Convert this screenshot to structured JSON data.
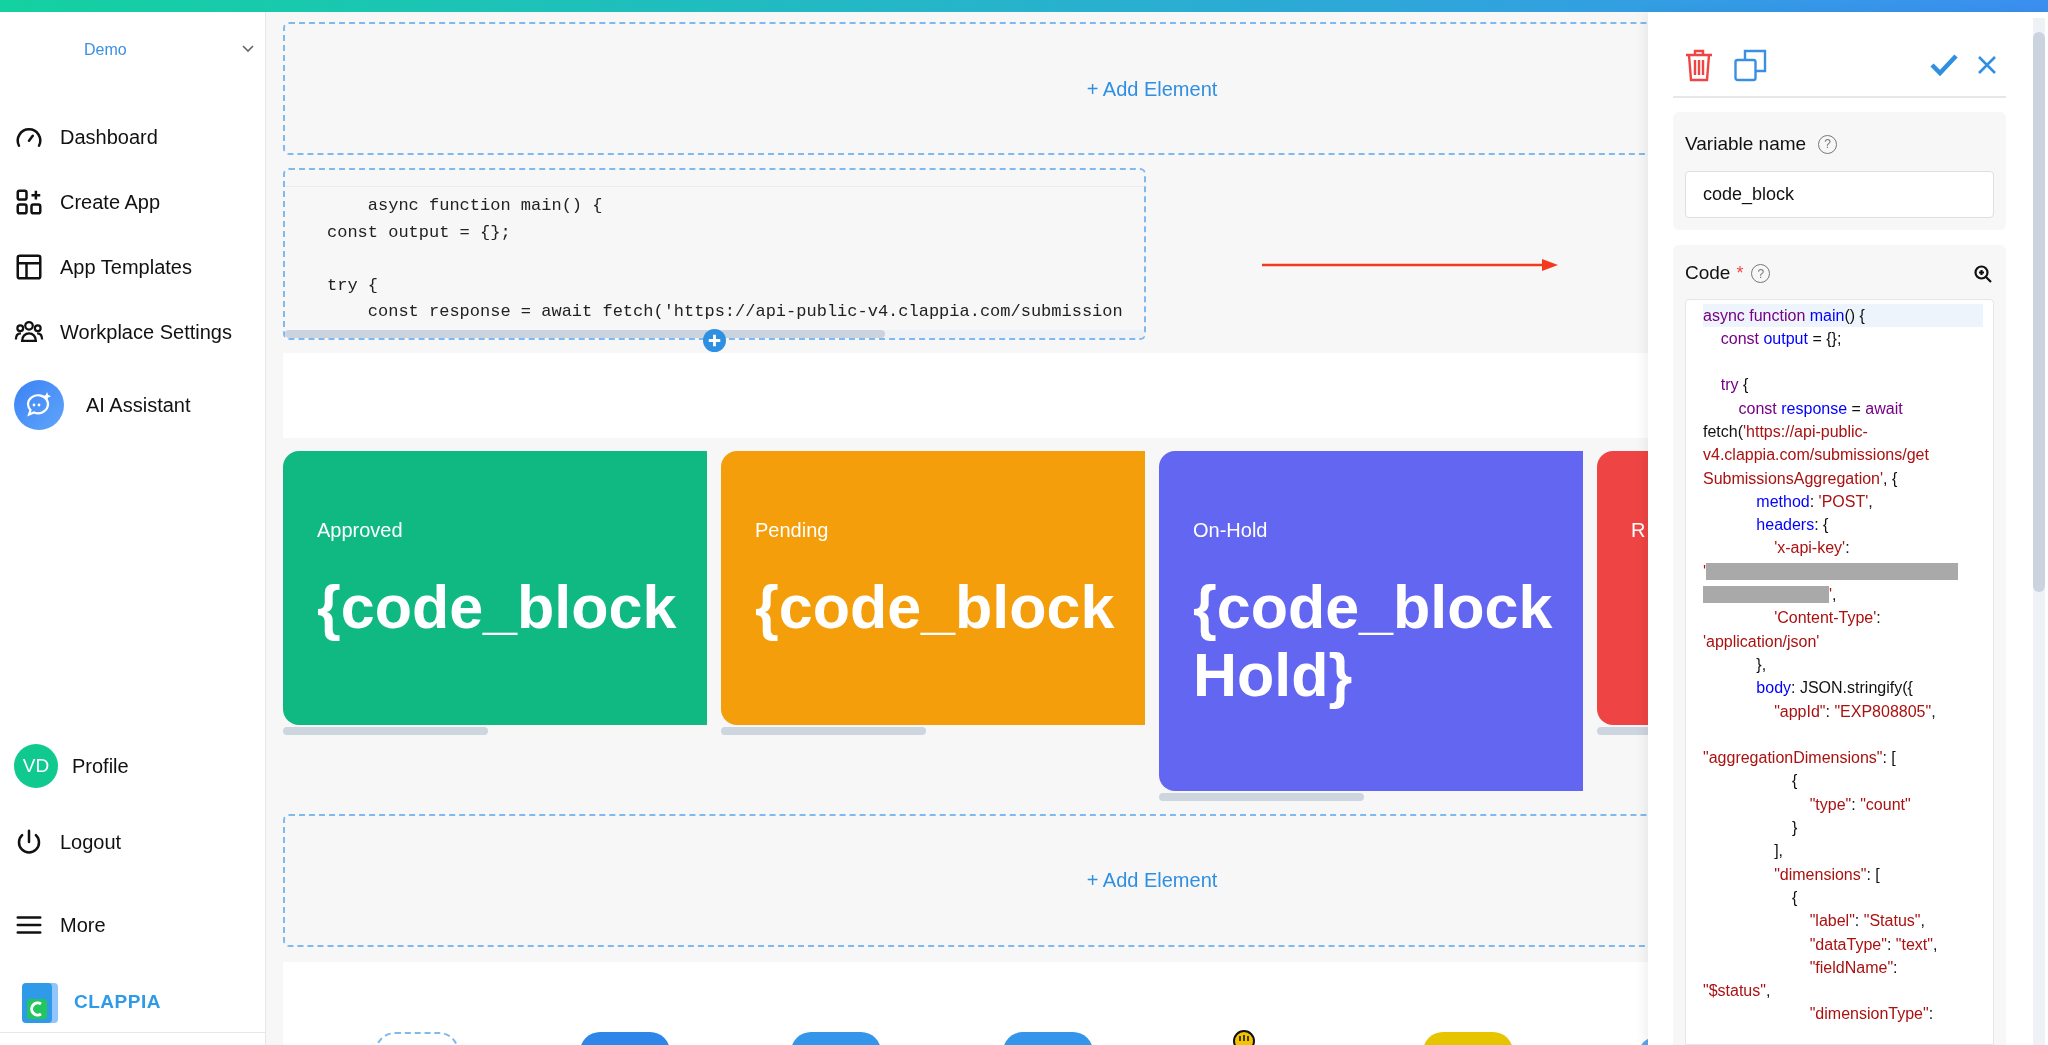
{
  "sidebar": {
    "workspace": "Demo",
    "items": [
      {
        "label": "Dashboard",
        "kind": "gauge"
      },
      {
        "label": "Create App",
        "kind": "grid-plus"
      },
      {
        "label": "App Templates",
        "kind": "layout"
      },
      {
        "label": "Workplace Settings",
        "kind": "users"
      },
      {
        "label": "AI Assistant",
        "kind": "ai"
      }
    ],
    "bottom_items": [
      {
        "label": "Profile",
        "kind": "avatar",
        "initials": "VD"
      },
      {
        "label": "Logout",
        "kind": "power"
      },
      {
        "label": "More",
        "kind": "menu"
      }
    ],
    "brand": "CLAPPIA"
  },
  "canvas": {
    "add_element_top": "+ Add Element",
    "code_preview": [
      [
        "    async function main() {",
        "const output = {};"
      ],
      [
        "try {",
        "    const response = await fetch('https://api-public-v4.clappia.com/submission"
      ]
    ],
    "cards": [
      {
        "label": "Approved",
        "value": "{code_block",
        "color": "#10b981"
      },
      {
        "label": "Pending",
        "value": "{code_block",
        "color": "#f59e0b"
      },
      {
        "label": "On-Hold",
        "value": "{code_block Hold}",
        "color": "#6366f1"
      },
      {
        "label": "R",
        "color": "#ef4444"
      }
    ],
    "add_element_bottom": "+ Add Element"
  },
  "panel": {
    "help_mark": "?",
    "variable_label": "Variable name",
    "variable_value": "code_block",
    "code_label": "Code",
    "required_mark": "*",
    "code_lines": [
      {
        "highlighted": true,
        "tokens": [
          {
            "kind": "keyword",
            "text": "async function "
          },
          {
            "kind": "name",
            "text": "main"
          },
          {
            "kind": "plain",
            "text": "() {"
          }
        ]
      },
      {
        "highlighted": false,
        "tokens": [
          {
            "kind": "keyword",
            "text": "    const "
          },
          {
            "kind": "name",
            "text": "output"
          },
          {
            "kind": "plain",
            "text": " = {};"
          }
        ]
      },
      {
        "highlighted": false,
        "gap_before": true,
        "tokens": [
          {
            "kind": "keyword",
            "text": "    try"
          },
          {
            "kind": "plain",
            "text": " {"
          }
        ]
      },
      {
        "highlighted": false,
        "tokens": [
          {
            "kind": "keyword",
            "text": "        const "
          },
          {
            "kind": "name",
            "text": "response"
          },
          {
            "kind": "plain",
            "text": " = "
          },
          {
            "kind": "keyword",
            "text": "await"
          }
        ]
      },
      {
        "highlighted": false,
        "tokens": [
          {
            "kind": "plain",
            "text": "fetch("
          },
          {
            "kind": "string",
            "text": "'https://api-public-"
          }
        ]
      },
      {
        "highlighted": false,
        "tokens": [
          {
            "kind": "string",
            "text": "v4.clappia.com/submissions/get"
          }
        ]
      },
      {
        "highlighted": false,
        "tokens": [
          {
            "kind": "string",
            "text": "SubmissionsAggregation'"
          },
          {
            "kind": "plain",
            "text": ", {"
          }
        ]
      },
      {
        "highlighted": false,
        "tokens": [
          {
            "kind": "name",
            "text": "            method"
          },
          {
            "kind": "plain",
            "text": ": "
          },
          {
            "kind": "string",
            "text": "'POST'"
          },
          {
            "kind": "plain",
            "text": ","
          }
        ]
      },
      {
        "highlighted": false,
        "tokens": [
          {
            "kind": "name",
            "text": "            headers"
          },
          {
            "kind": "plain",
            "text": ": {"
          }
        ]
      },
      {
        "highlighted": false,
        "tokens": [
          {
            "kind": "string",
            "text": "                'x-api-key'"
          },
          {
            "kind": "plain",
            "text": ":"
          }
        ]
      },
      {
        "highlighted": false,
        "tokens": [
          {
            "kind": "string",
            "text": "'"
          },
          {
            "kind": "redacted"
          }
        ]
      },
      {
        "highlighted": false,
        "tokens": [
          {
            "kind": "redacted"
          },
          {
            "kind": "string",
            "text": "'"
          },
          {
            "kind": "plain",
            "text": ","
          }
        ]
      },
      {
        "highlighted": false,
        "tokens": [
          {
            "kind": "string",
            "text": "                'Content-Type'"
          },
          {
            "kind": "plain",
            "text": ":"
          }
        ]
      },
      {
        "highlighted": false,
        "tokens": [
          {
            "kind": "string",
            "text": "'application/json'"
          }
        ]
      },
      {
        "highlighted": false,
        "tokens": [
          {
            "kind": "plain",
            "text": "            },"
          }
        ]
      },
      {
        "highlighted": false,
        "tokens": [
          {
            "kind": "name",
            "text": "            body"
          },
          {
            "kind": "plain",
            "text": ": JSON.stringify({"
          }
        ]
      },
      {
        "highlighted": false,
        "tokens": [
          {
            "kind": "string",
            "text": "                \"appId\""
          },
          {
            "kind": "plain",
            "text": ": "
          },
          {
            "kind": "string",
            "text": "\"EXP808805\""
          },
          {
            "kind": "plain",
            "text": ","
          }
        ]
      },
      {
        "highlighted": false,
        "gap_before": true,
        "tokens": [
          {
            "kind": "string",
            "text": "\"aggregationDimensions\""
          },
          {
            "kind": "plain",
            "text": ": ["
          }
        ]
      },
      {
        "highlighted": false,
        "tokens": [
          {
            "kind": "plain",
            "text": "                    {"
          }
        ]
      },
      {
        "highlighted": false,
        "tokens": [
          {
            "kind": "string",
            "text": "                        \"type\""
          },
          {
            "kind": "plain",
            "text": ": "
          },
          {
            "kind": "string",
            "text": "\"count\""
          }
        ]
      },
      {
        "highlighted": false,
        "tokens": [
          {
            "kind": "plain",
            "text": "                    }"
          }
        ]
      },
      {
        "highlighted": false,
        "tokens": [
          {
            "kind": "plain",
            "text": "                ],"
          }
        ]
      },
      {
        "highlighted": false,
        "tokens": [
          {
            "kind": "string",
            "text": "                \"dimensions\""
          },
          {
            "kind": "plain",
            "text": ": ["
          }
        ]
      },
      {
        "highlighted": false,
        "tokens": [
          {
            "kind": "plain",
            "text": "                    {"
          }
        ]
      },
      {
        "highlighted": false,
        "tokens": [
          {
            "kind": "string",
            "text": "                        \"label\""
          },
          {
            "kind": "plain",
            "text": ": "
          },
          {
            "kind": "string",
            "text": "\"Status\""
          },
          {
            "kind": "plain",
            "text": ","
          }
        ]
      },
      {
        "highlighted": false,
        "tokens": [
          {
            "kind": "string",
            "text": "                        \"dataType\""
          },
          {
            "kind": "plain",
            "text": ": "
          },
          {
            "kind": "string",
            "text": "\"text\""
          },
          {
            "kind": "plain",
            "text": ","
          }
        ]
      },
      {
        "highlighted": false,
        "tokens": [
          {
            "kind": "string",
            "text": "                        \"fieldName\""
          },
          {
            "kind": "plain",
            "text": ":"
          }
        ]
      },
      {
        "highlighted": false,
        "tokens": [
          {
            "kind": "string",
            "text": "\"$status\""
          },
          {
            "kind": "plain",
            "text": ","
          }
        ]
      },
      {
        "highlighted": false,
        "tokens": [
          {
            "kind": "string",
            "text": "                        \"dimensionType\""
          },
          {
            "kind": "plain",
            "text": ":"
          }
        ]
      }
    ]
  }
}
